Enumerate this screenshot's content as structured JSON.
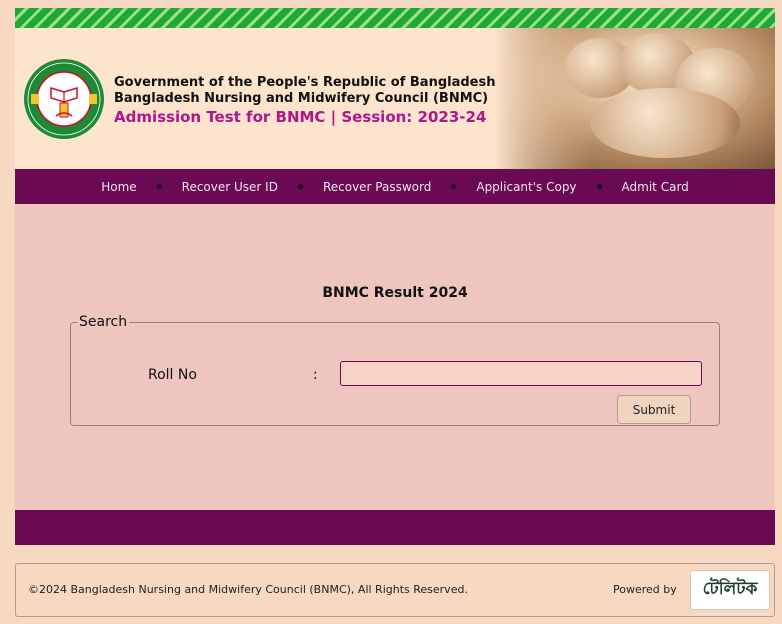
{
  "header": {
    "line1": "Government of the People's Republic of Bangladesh",
    "line2": "Bangladesh Nursing and Midwifery Council (BNMC)",
    "line3": "Admission Test for BNMC | Session: 2023-24"
  },
  "nav": {
    "items": [
      "Home",
      "Recover User ID",
      "Recover Password",
      "Applicant's Copy",
      "Admit Card"
    ]
  },
  "main": {
    "title": "BNMC Result 2024",
    "fieldset_legend": "Search",
    "roll_label": "Roll No",
    "colon": ":",
    "roll_value": "",
    "submit_label": "Submit"
  },
  "footer": {
    "copyright": "©2024 Bangladesh Nursing and Midwifery Council (BNMC), All Rights Reserved.",
    "powered_by": "Powered by",
    "brand_logo": "টেলিটক"
  },
  "colors": {
    "nav_bg": "#6a0a55",
    "accent_magenta": "#b2148c",
    "main_bg": "#efc5c0",
    "stripe_green": "#1fa83a"
  },
  "icons": {
    "logo": "bnmc-seal-icon",
    "brand": "teletalk-logo-icon"
  }
}
